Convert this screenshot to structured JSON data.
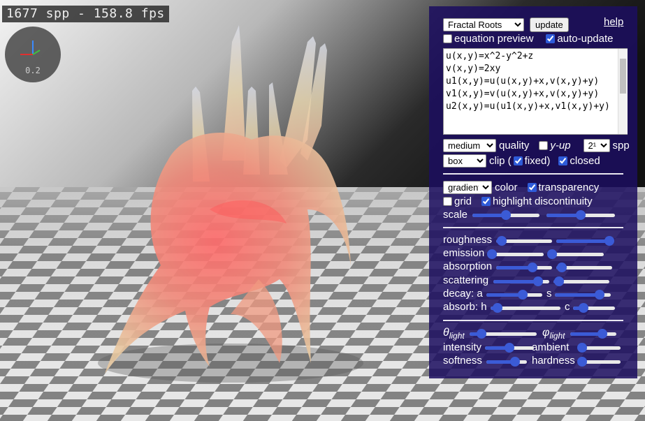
{
  "status": {
    "fps_text": "1677 spp - 158.8 fps"
  },
  "gizmo": {
    "label": "0.2"
  },
  "panel": {
    "preset": "Fractal Roots",
    "update_label": "update",
    "help_label": "help",
    "equation_preview": {
      "label": "equation preview",
      "checked": false
    },
    "auto_update": {
      "label": "auto-update",
      "checked": true
    },
    "equation_text": "u(x,y)=x^2-y^2+z\nv(x,y)=2xy\nu1(x,y)=u(u(x,y)+x,v(x,y)+y)\nv1(x,y)=v(u(x,y)+x,v(x,y)+y)\nu2(x,y)=u(u1(x,y)+x,v1(x,y)+y)",
    "quality": {
      "value": "medium",
      "label": "quality"
    },
    "y_up": {
      "label": "y-up",
      "checked": false
    },
    "spp": {
      "value": "2¹⁴",
      "label": "spp"
    },
    "clip": {
      "value": "box",
      "label": "clip (",
      "fixed_label": "fixed)",
      "fixed_checked": true,
      "closed_label": "closed",
      "closed_checked": true
    },
    "color": {
      "value": "gradient",
      "label": "color"
    },
    "transparency": {
      "label": "transparency",
      "checked": true
    },
    "grid": {
      "label": "grid",
      "checked": false
    },
    "highlight": {
      "label": "highlight discontinuity",
      "checked": true
    },
    "scale_label": "scale",
    "roughness_label": "roughness",
    "emission_label": "emission",
    "absorption_label": "absorption",
    "scattering_label": "scattering",
    "decay_a_label": "decay: a",
    "decay_s_label": "s",
    "absorb_h_label": "absorb: h",
    "absorb_c_label": "c",
    "theta_label": "θ",
    "theta_sub": "light",
    "phi_label": "φ",
    "phi_sub": "light",
    "intensity_label": "intensity",
    "ambient_label": "ambient",
    "softness_label": "softness",
    "hardness_label": "hardness",
    "sliders": {
      "scale_1": 0.5,
      "scale_2": 0.5,
      "roughness_1": 0.1,
      "roughness_2": 0.95,
      "emission_1": 0.05,
      "emission_2": 0.05,
      "absorption_1": 0.65,
      "absorption_2": 0.1,
      "scattering_1": 0.8,
      "scattering_2": 0.1,
      "decay_a": 0.65,
      "decay_s": 0.8,
      "absorb_h": 0.1,
      "absorb_c": 0.25,
      "theta": 0.18,
      "phi": 0.7,
      "intensity": 0.5,
      "ambient": 0.05,
      "softness": 0.7,
      "hardness": 0.05
    },
    "accent_color": "#3b5bd6"
  }
}
